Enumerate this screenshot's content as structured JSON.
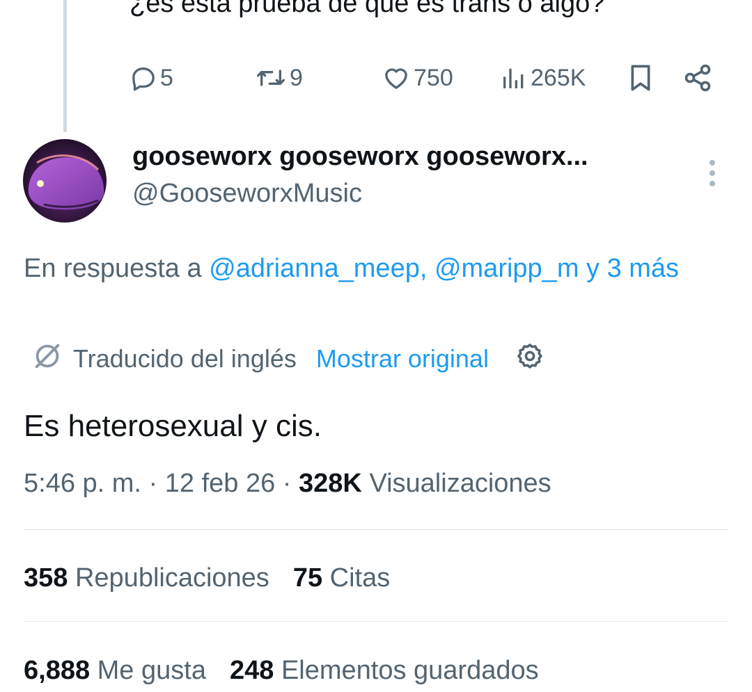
{
  "previous_tweet": {
    "text": "¿es esta prueba de que es trans o algo?",
    "actions": {
      "replies": "5",
      "reposts": "9",
      "likes": "750",
      "views": "265K"
    }
  },
  "tweet": {
    "display_name": "gooseworx gooseworx gooseworx...",
    "handle": "@GooseworxMusic",
    "reply_prefix": "En respuesta a ",
    "reply_mentions": "@adrianna_meep, @maripp_m y 3 más",
    "translated_label": "Traducido del inglés",
    "show_original": "Mostrar original",
    "text": "Es heterosexual y cis.",
    "time": "5:46 p. m.",
    "date": "12 feb 26",
    "views_count": "328K",
    "views_label": "Visualizaciones",
    "reposts_count": "358",
    "reposts_label": "Republicaciones",
    "quotes_count": "75",
    "quotes_label": "Citas",
    "likes_count": "6,888",
    "likes_label": "Me gusta",
    "bookmarks_count": "248",
    "bookmarks_label": "Elementos guardados"
  },
  "colors": {
    "accent": "#1d9bf0",
    "secondary_text": "#536471",
    "primary_text": "#0f1419",
    "divider": "#e1e6ea"
  },
  "icons": [
    "reply-icon",
    "repost-icon",
    "like-icon",
    "views-icon",
    "bookmark-icon",
    "share-icon",
    "more-options-icon",
    "translate-icon",
    "settings-gear-icon"
  ]
}
